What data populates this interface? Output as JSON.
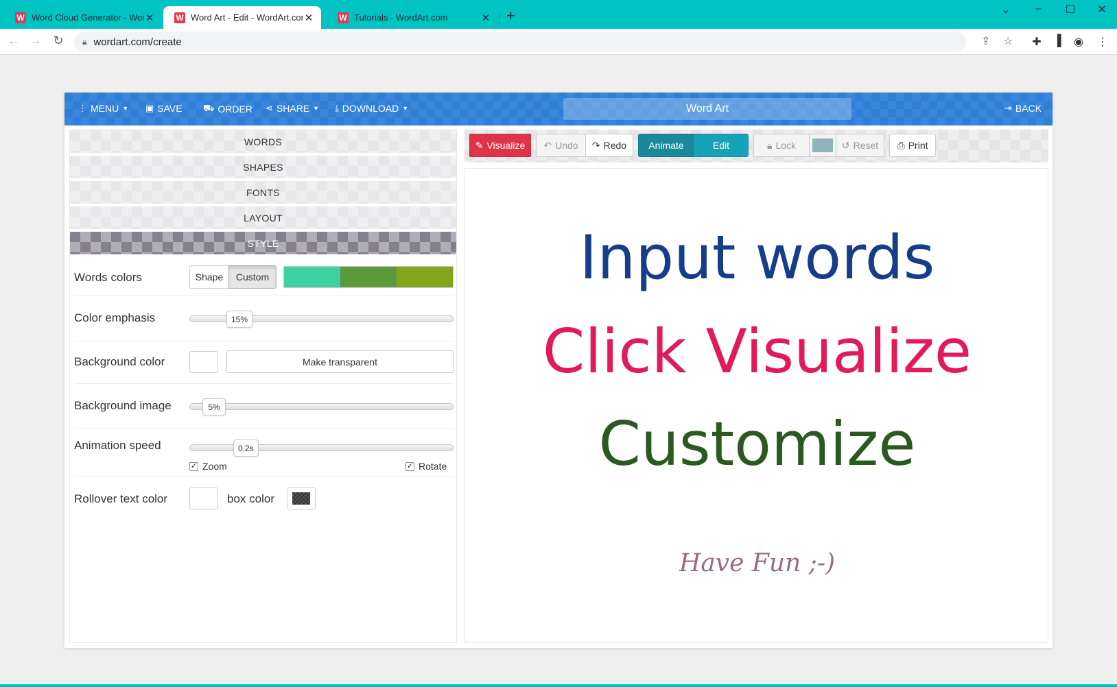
{
  "browser": {
    "tabs": [
      {
        "title": "Word Cloud Generator - Word",
        "active": false
      },
      {
        "title": "Word Art - Edit - WordArt.com",
        "active": true
      },
      {
        "title": "Tutorials - WordArt.com",
        "active": false
      }
    ],
    "favicon_letter": "W",
    "url": "wordart.com/create",
    "colors": {
      "chrome": "#00c4c4"
    }
  },
  "topnav": {
    "menu": "MENU",
    "save": "SAVE",
    "order": "ORDER",
    "share": "SHARE",
    "download": "DOWNLOAD",
    "title": "Word Art",
    "back": "BACK",
    "color": "#2f7fd8"
  },
  "sections": [
    "WORDS",
    "SHAPES",
    "FONTS",
    "LAYOUT",
    "STYLE"
  ],
  "style": {
    "words_colors": {
      "label": "Words colors",
      "shape_btn": "Shape",
      "custom_btn": "Custom",
      "palette": [
        "#3dd1a1",
        "#5a9a3a",
        "#84a519"
      ]
    },
    "color_emphasis": {
      "label": "Color emphasis",
      "value": "15%",
      "fraction": 0.15
    },
    "background_color": {
      "label": "Background color",
      "transparent_btn": "Make transparent"
    },
    "background_image": {
      "label": "Background image",
      "value": "5%",
      "fraction": 0.05
    },
    "animation_speed": {
      "label": "Animation speed",
      "value": "0.2s",
      "fraction": 0.2,
      "zoom": "Zoom",
      "rotate": "Rotate"
    },
    "rollover": {
      "label": "Rollover text color",
      "box_label": "box color"
    }
  },
  "toolbar": {
    "visualize": "Visualize",
    "undo": "Undo",
    "redo": "Redo",
    "animate": "Animate",
    "edit": "Edit",
    "lock": "Lock",
    "reset": "Reset",
    "print": "Print"
  },
  "canvas": {
    "line1": {
      "text": "Input words",
      "color": "#153d8a"
    },
    "line2": {
      "text": "Click Visualize",
      "color": "#e2195b"
    },
    "line3": {
      "text": "Customize",
      "color": "#2b5a1f"
    },
    "fun": "Have Fun ;-)"
  }
}
